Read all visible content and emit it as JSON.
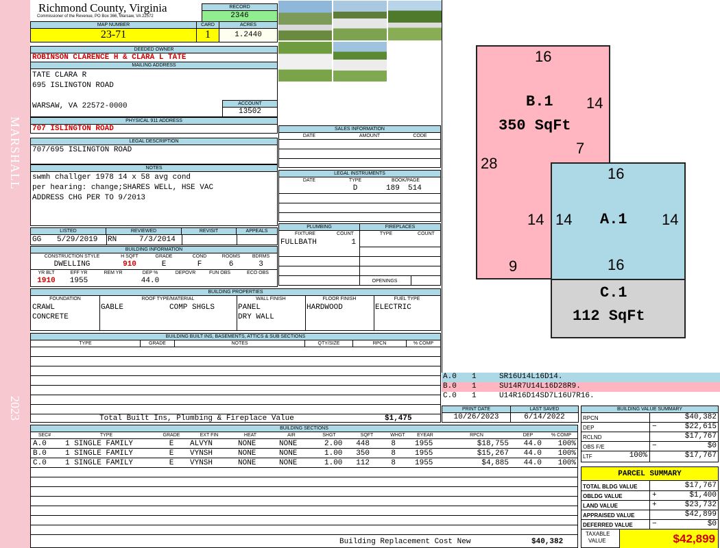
{
  "sidebar": {
    "district": "MARSHALL",
    "year": "2023"
  },
  "header": {
    "county": "Richmond County, Virginia",
    "address_line": "Commissioner of the Revenue, PO Box 366, Warsaw, VA 22572",
    "record_label": "RECORD",
    "record": "2346",
    "map_label": "MAP NUMBER",
    "map_number": "23-71",
    "card_label": "CARD",
    "card": "1",
    "acres_label": "ACRES",
    "acres": "1.2440"
  },
  "owner": {
    "label": "DEEDED OWNER",
    "name": "ROBINSON CLARENCE H & CLARA L TATE"
  },
  "mailing": {
    "label": "MAILING ADDRESS",
    "line1": "TATE CLARA R",
    "line2": "695 ISLINGTON ROAD",
    "line3": "WARSAW, VA 22572-0000",
    "account_label": "ACCOUNT",
    "account": "13502"
  },
  "physical": {
    "label": "PHYSICAL 911 ADDRESS",
    "address": "707 ISLINGTON ROAD"
  },
  "legal": {
    "label": "LEGAL DESCRIPTION",
    "text": "707/695 ISLINGTON ROAD"
  },
  "notes": {
    "label": "NOTES",
    "line1": "swmh challger 1978 14 x 58 avg cond",
    "line2": "per hearing: change;SHARES WELL, HSE VAC",
    "line3": "ADDRESS CHG PER TO 9/2013"
  },
  "listing": {
    "listed_label": "LISTED",
    "reviewed_label": "REVIEWED",
    "revisit_label": "REVISIT",
    "appeals_label": "APPEALS",
    "lister": "GG",
    "listed_date": "5/29/2019",
    "reviewer": "RN",
    "reviewed_date": "7/3/2014"
  },
  "building_info": {
    "label": "BUILDING INFORMATION",
    "headers": [
      "CONSTRUCTION STYLE",
      "H SQFT",
      "GRADE",
      "COND",
      "ROOMS",
      "BDRMS"
    ],
    "values": [
      "DWELLING",
      "910",
      "E",
      "F",
      "6",
      "3"
    ],
    "headers2": [
      "YR BLT",
      "EFF YR",
      "REM YR",
      "DEP %",
      "DEPOVR",
      "FUN OBS",
      "ECO OBS"
    ],
    "values2": [
      "1910",
      "1955",
      "",
      "44.0",
      "",
      "",
      ""
    ]
  },
  "sales": {
    "label": "SALES INFORMATION",
    "headers": [
      "DATE",
      "AMOUNT",
      "CODE"
    ]
  },
  "instruments": {
    "label": "LEGAL INSTRUMENTS",
    "headers": [
      "DATE",
      "TYPE",
      "BOOK/PAGE"
    ],
    "row": {
      "date": "",
      "type": "D",
      "book": "189",
      "page": "514"
    }
  },
  "plumbing": {
    "label": "PLUMBING",
    "headers": [
      "FIXTURE",
      "COUNT"
    ],
    "fixture": "FULLBATH",
    "count": "1"
  },
  "fireplaces": {
    "label": "FIREPLACES",
    "headers": [
      "TYPE",
      "COUNT"
    ],
    "openings_label": "OPENINGS"
  },
  "properties": {
    "label": "BUILDING PROPERTIES",
    "headers": [
      "FOUNDATION",
      "ROOF TYPE/MATERIAL",
      "WALL FINISH",
      "FLOOR FINISH",
      "FUEL TYPE"
    ],
    "foundation1": "CRAWL",
    "foundation2": "CONCRETE",
    "roof_type": "GABLE",
    "roof_mat": "COMP SHGLS",
    "wall1": "PANEL",
    "wall2": "DRY WALL",
    "floor": "HARDWOOD",
    "fuel": "ELECTRIC"
  },
  "builtins": {
    "label": "BUILDING BUILT INS, BASEMENTS, ATTICS & SUB SECTIONS",
    "headers": [
      "TYPE",
      "GRADE",
      "NOTES",
      "QTY/SIZE",
      "RPCN",
      "% COMP"
    ],
    "total_label": "Total Built Ins, Plumbing & Fireplace Value",
    "total": "$1,475"
  },
  "sections": {
    "label": "BUILDING SECTIONS",
    "headers": [
      "SEC#",
      "TYPE",
      "GRADE",
      "EXT FIN",
      "HEAT",
      "AIR",
      "SHGT",
      "SQFT",
      "WHGT",
      "EYEAR",
      "RPCN",
      "DEP",
      "% COMP"
    ],
    "rows": [
      [
        "A.0",
        "1 SINGLE FAMILY",
        "E",
        "ALVYN",
        "NONE",
        "NONE",
        "2.00",
        "448",
        "8",
        "1955",
        "$18,755",
        "44.0",
        "100%"
      ],
      [
        "B.0",
        "1 SINGLE FAMILY",
        "E",
        "VYNSH",
        "NONE",
        "NONE",
        "1.00",
        "350",
        "8",
        "1955",
        "$15,267",
        "44.0",
        "100%"
      ],
      [
        "C.0",
        "1 SINGLE FAMILY",
        "E",
        "VYNSH",
        "NONE",
        "NONE",
        "1.00",
        "112",
        "8",
        "1955",
        "$4,885",
        "44.0",
        "100%"
      ]
    ],
    "replacement_label": "Building Replacement Cost New",
    "replacement": "$40,382"
  },
  "sketch": {
    "b": {
      "name": "B.1",
      "area": "350 SqFt",
      "top": "16",
      "right": "14",
      "right2": "7",
      "left": "28",
      "bottom": "9"
    },
    "a": {
      "name": "A.1",
      "top": "16",
      "left": "14",
      "right": "14",
      "bottom": "16",
      "left_outer": "14"
    },
    "c": {
      "name": "C.1",
      "area": "112 SqFt"
    },
    "codes": [
      {
        "sec": "A.0",
        "num": "1",
        "code": "SR16U14L16D14.",
        "color": "#add8e6"
      },
      {
        "sec": "B.0",
        "num": "1",
        "code": "SU14R7U14L16D28R9.",
        "color": "#ffb6c1"
      },
      {
        "sec": "C.0",
        "num": "1",
        "code": "U14R16D14SD7L16U7R16.",
        "color": "#ffffff"
      }
    ]
  },
  "dates": {
    "print_label": "PRINT DATE",
    "print": "10/26/2023",
    "saved_label": "LAST SAVED",
    "saved": "6/14/2022"
  },
  "value_summary": {
    "label": "BUILDING VALUE SUMMARY",
    "rpcn_label": "RPCN",
    "rpcn": "$40,382",
    "dep_label": "DEP",
    "dep_sign": "−",
    "dep": "$22,615",
    "rclnd_label": "RCLND",
    "rclnd": "$17,767",
    "obs_label": "OBS F/E",
    "obs_sign": "−",
    "obs": "$0",
    "ltf_label": "LTF",
    "ltf_pct": "100%",
    "ltf": "$17,767"
  },
  "parcel": {
    "label": "PARCEL SUMMARY",
    "bldg_label": "TOTAL BLDG VALUE",
    "bldg": "$17,767",
    "obldg_label": "OBLDG VALUE",
    "obldg_sign": "+",
    "obldg": "$1,400",
    "land_label": "LAND VALUE",
    "land_sign": "+",
    "land": "$23,732",
    "appraised_label": "APPRAISED VALUE",
    "appraised": "$42,899",
    "deferred_label": "DEFERRED VALUE",
    "deferred_sign": "−",
    "deferred": "$0",
    "taxable_label1": "TAXABLE",
    "taxable_label2": "VALUE",
    "taxable": "$42,899"
  }
}
